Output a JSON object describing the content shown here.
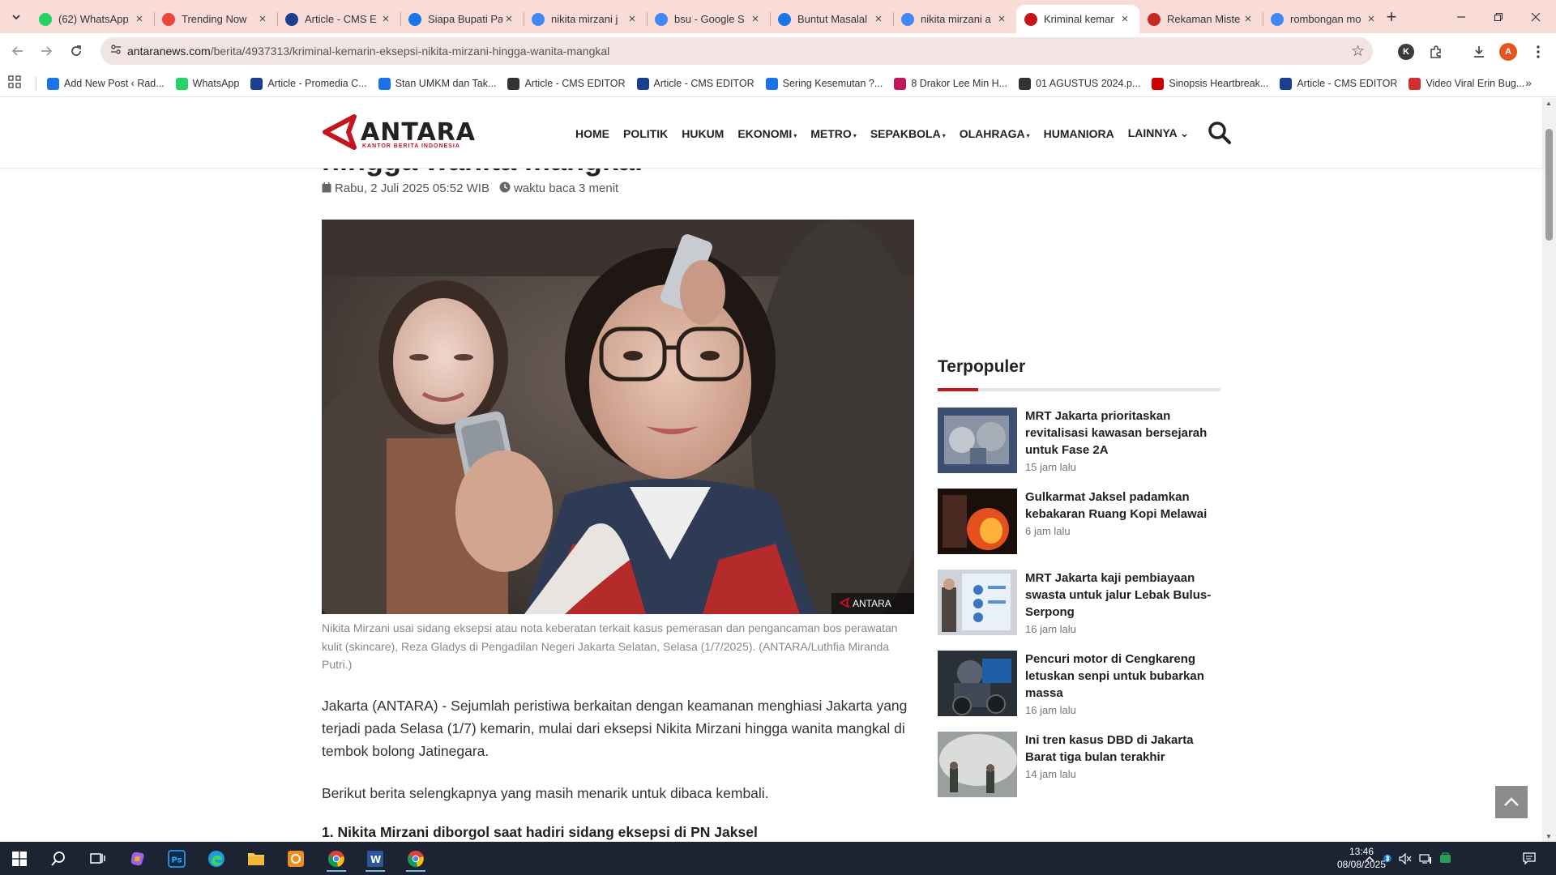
{
  "browser": {
    "tabs": [
      {
        "title": "(62) WhatsApp",
        "favicon": "whatsapp-icon",
        "color": "#25d366",
        "active": false
      },
      {
        "title": "Trending Now",
        "favicon": "trend-icon",
        "color": "#e8453c",
        "active": false
      },
      {
        "title": "Article - CMS E",
        "favicon": "cms-icon",
        "color": "#1a3f8f",
        "active": false
      },
      {
        "title": "Siapa Bupati Pa",
        "favicon": "doc-icon",
        "color": "#1a73e8",
        "active": false
      },
      {
        "title": "nikita mirzani j",
        "favicon": "google-icon",
        "color": "#4285f4",
        "active": false
      },
      {
        "title": "bsu - Google S",
        "favicon": "google-icon",
        "color": "#4285f4",
        "active": false
      },
      {
        "title": "Buntut Masalal",
        "favicon": "doc-icon",
        "color": "#1a73e8",
        "active": false
      },
      {
        "title": "nikita mirzani a",
        "favicon": "google-icon",
        "color": "#4285f4",
        "active": false
      },
      {
        "title": "Kriminal kemar",
        "favicon": "antara-icon",
        "color": "#c6141d",
        "active": true
      },
      {
        "title": "Rekaman Miste",
        "favicon": "red-circle-icon",
        "color": "#c62828",
        "active": false
      },
      {
        "title": "rombongan mo",
        "favicon": "google-icon",
        "color": "#4285f4",
        "active": false
      }
    ],
    "url_domain": "antaranews.com",
    "url_path": "/berita/4937313/kriminal-kemarin-eksepsi-nikita-mirzani-hingga-wanita-mangkal",
    "profile_k": "K",
    "profile_a": "A",
    "bookmarks": [
      {
        "label": "Add New Post ‹ Rad...",
        "color": "#1a73e8"
      },
      {
        "label": "WhatsApp",
        "color": "#25d366"
      },
      {
        "label": "Article - Promedia C...",
        "color": "#1a3f8f"
      },
      {
        "label": "Stan UMKM dan Tak...",
        "color": "#1a73e8"
      },
      {
        "label": "Article - CMS EDITOR",
        "color": "#333333"
      },
      {
        "label": "Article - CMS EDITOR",
        "color": "#1a3f8f"
      },
      {
        "label": "Sering Kesemutan ?...",
        "color": "#1a73e8"
      },
      {
        "label": "8 Drakor Lee Min H...",
        "color": "#c2185b"
      },
      {
        "label": "01 AGUSTUS 2024.p...",
        "color": "#333333"
      },
      {
        "label": "Sinopsis Heartbreak...",
        "color": "#cc0000"
      },
      {
        "label": "Article - CMS EDITOR",
        "color": "#1a3f8f"
      },
      {
        "label": "Video Viral Erin Bug...",
        "color": "#d32f2f"
      }
    ]
  },
  "site": {
    "logo_word": "ANTARA",
    "logo_sub": "KANTOR BERITA INDONESIA",
    "brand_color": "#c6141d",
    "nav": [
      {
        "label": "HOME",
        "caret": ""
      },
      {
        "label": "POLITIK",
        "caret": ""
      },
      {
        "label": "HUKUM",
        "caret": ""
      },
      {
        "label": "EKONOMI",
        "caret": "▾"
      },
      {
        "label": "METRO",
        "caret": "▾"
      },
      {
        "label": "SEPAKBOLA",
        "caret": "▾"
      },
      {
        "label": "OLAHRAGA",
        "caret": "▾"
      },
      {
        "label": "HUMANIORA",
        "caret": ""
      },
      {
        "label": "LAINNYA",
        "caret": "⌄"
      }
    ]
  },
  "article": {
    "title_tail": "hingga wanita mangkal",
    "date": "Rabu, 2 Juli 2025 05:52 WIB",
    "read_time": "waktu baca 3 menit",
    "photo_badge": "ANTARA",
    "caption": "Nikita Mirzani usai sidang eksepsi atau nota keberatan terkait kasus pemerasan dan pengancaman bos perawatan kulit (skincare), Reza Gladys di Pengadilan Negeri Jakarta Selatan, Selasa (1/7/2025). (ANTARA/Luthfia Miranda Putri.)",
    "lead": "Jakarta (ANTARA) - Sejumlah peristiwa berkaitan dengan keamanan menghiasi Jakarta yang terjadi pada Selasa (1/7) kemarin, mulai dari eksepsi Nikita Mirzani hingga wanita mangkal di tembok bolong Jatinegara.",
    "para2": "Berikut berita selengkapnya yang masih menarik untuk dibaca kembali.",
    "subhead": "1. Nikita Mirzani diborgol saat hadiri sidang eksepsi di PN Jaksel"
  },
  "sidebar": {
    "title": "Terpopuler",
    "items": [
      {
        "title": "MRT Jakarta prioritaskan revitalisasi kawasan bersejarah untuk Fase 2A",
        "time": "15 jam lalu"
      },
      {
        "title": "Gulkarmat Jaksel padamkan kebakaran Ruang Kopi Melawai",
        "time": "6 jam lalu"
      },
      {
        "title": "MRT Jakarta kaji pembiayaan swasta untuk jalur Lebak Bulus-Serpong",
        "time": "16 jam lalu"
      },
      {
        "title": "Pencuri motor di Cengkareng letuskan senpi untuk bubarkan massa",
        "time": "16 jam lalu"
      },
      {
        "title": "Ini tren kasus DBD di Jakarta Barat tiga bulan terakhir",
        "time": "14 jam lalu"
      }
    ]
  },
  "taskbar": {
    "time": "13:46",
    "date": "08/08/2025"
  }
}
